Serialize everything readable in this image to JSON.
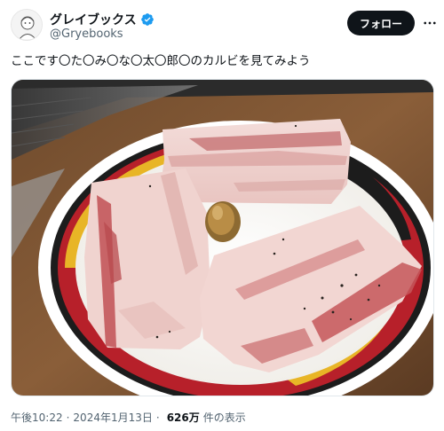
{
  "author": {
    "display_name": "グレイブックス",
    "handle": "@Gryebooks",
    "verified": true,
    "avatar_icon": "cartoon-avatar-icon"
  },
  "actions": {
    "follow_label": "フォロー",
    "more_icon": "more-horizontal-icon"
  },
  "tweet": {
    "text": "ここです〇た〇み〇な〇太〇郎〇のカルビを見てみよう"
  },
  "media": {
    "photo_icon": "food-photo"
  },
  "meta": {
    "time": "午後10:22",
    "date": "2024年1月13日",
    "separator": "·",
    "views_count": "626万",
    "views_label": "件の表示"
  },
  "colors": {
    "text_primary": "#0f1419",
    "text_secondary": "#536471",
    "follow_bg": "#0f1419",
    "verified": "#1d9bf0"
  }
}
